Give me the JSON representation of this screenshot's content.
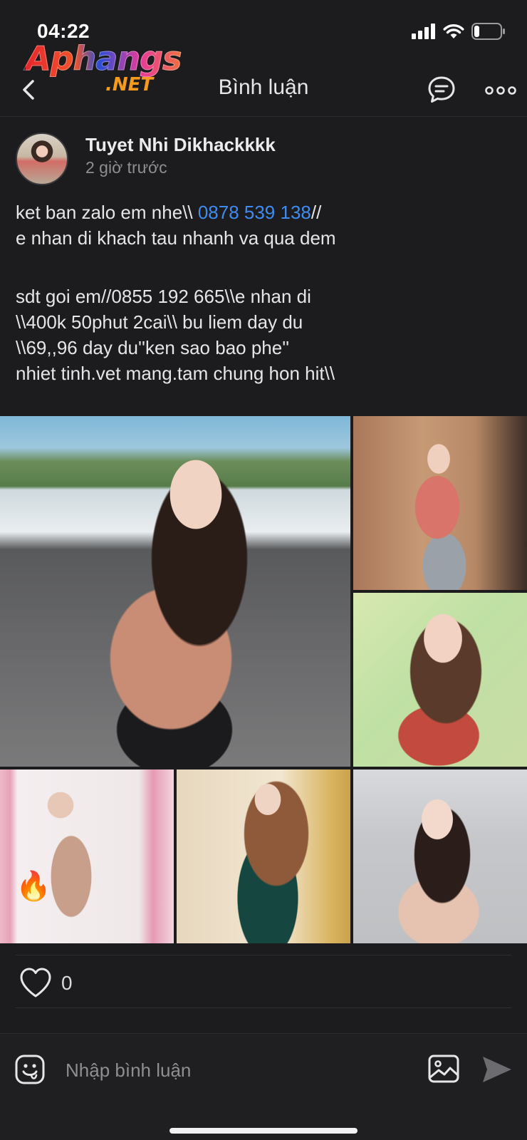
{
  "status_bar": {
    "time": "04:22",
    "battery_level": 0.2,
    "icons": [
      "signal-icon",
      "wifi-icon",
      "battery-icon"
    ]
  },
  "watermark": {
    "main": "Aphangs",
    "sub": ".NET"
  },
  "nav": {
    "title": "Bình luận",
    "icons": [
      "back-chevron-icon",
      "chat-bubble-icon",
      "more-dots-icon"
    ]
  },
  "post": {
    "author": "Tuyet Nhi Dikhackkkk",
    "time": "2 giờ trước",
    "line1_pre": "ket ban zalo em nhe\\\\ ",
    "line1_phone": "0878 539 138",
    "line1_post": "//",
    "line2": "e nhan di khach tau nhanh va qua dem",
    "line3": "sdt goi em//0855 192 665\\\\e nhan di",
    "line4": "\\\\400k 50phut 2cai\\\\ bu liem day du",
    "line5": "\\\\69,,96 day du''ken sao bao phe''",
    "line6": "nhiet tinh.vet mang.tam chung hon hit\\\\",
    "photo_count": 6,
    "sticker": "🔥"
  },
  "reactions": {
    "like_count": "0"
  },
  "composer": {
    "placeholder": "Nhập bình luận"
  },
  "colors": {
    "background": "#1c1c1e",
    "link": "#3f8cf0",
    "muted": "#8e8e93",
    "text": "#e6e6e8"
  }
}
